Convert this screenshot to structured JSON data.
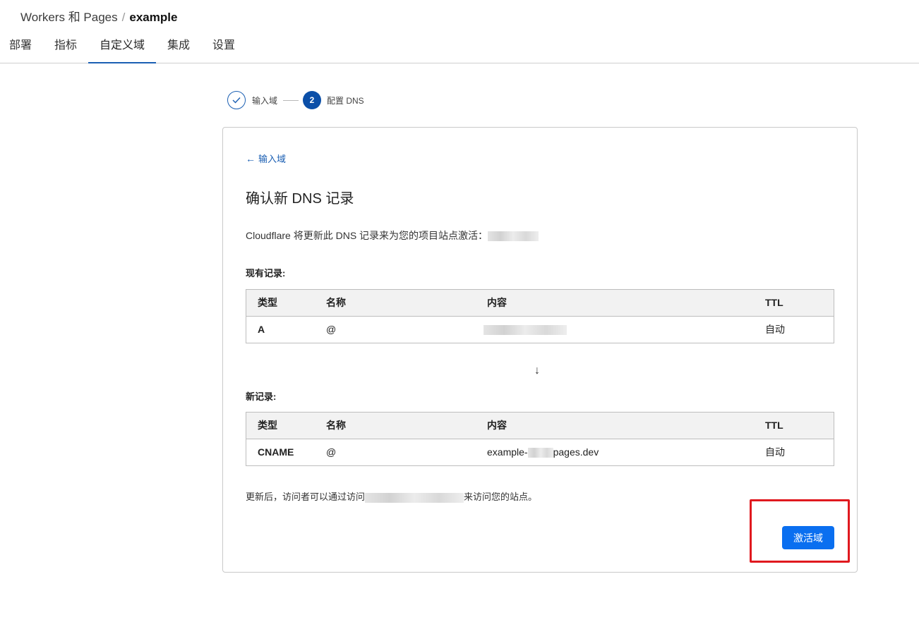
{
  "breadcrumb": {
    "parent": "Workers 和 Pages",
    "separator": "/",
    "current": "example"
  },
  "tabs": [
    {
      "label": "部署"
    },
    {
      "label": "指标"
    },
    {
      "label": "自定义域",
      "active": true
    },
    {
      "label": "集成"
    },
    {
      "label": "设置"
    }
  ],
  "stepper": {
    "step1_label": "输入域",
    "step2_number": "2",
    "step2_label": "配置 DNS"
  },
  "card": {
    "back_label": "输入域",
    "title": "确认新 DNS 记录",
    "description": "Cloudflare 将更新此 DNS 记录来为您的项目站点激活：",
    "existing_label": "现有记录:",
    "new_label": "新记录:",
    "footer_prefix": "更新后，访问者可以通过访问",
    "footer_suffix": "来访问您的站点。",
    "activate_label": "激活域"
  },
  "table_headers": {
    "type": "类型",
    "name": "名称",
    "content": "内容",
    "ttl": "TTL"
  },
  "existing_record": {
    "type": "A",
    "name": "@",
    "content": "",
    "ttl": "自动"
  },
  "new_record": {
    "type": "CNAME",
    "name": "@",
    "content_prefix": "example-",
    "content_suffix": "pages.dev",
    "ttl": "自动"
  },
  "colors": {
    "accent": "#1b5fb3",
    "button": "#0a6ff0",
    "highlight": "#e0191f"
  },
  "icons": {
    "step_done": "check-icon",
    "back": "arrow-left-icon",
    "down": "arrow-down-icon"
  }
}
